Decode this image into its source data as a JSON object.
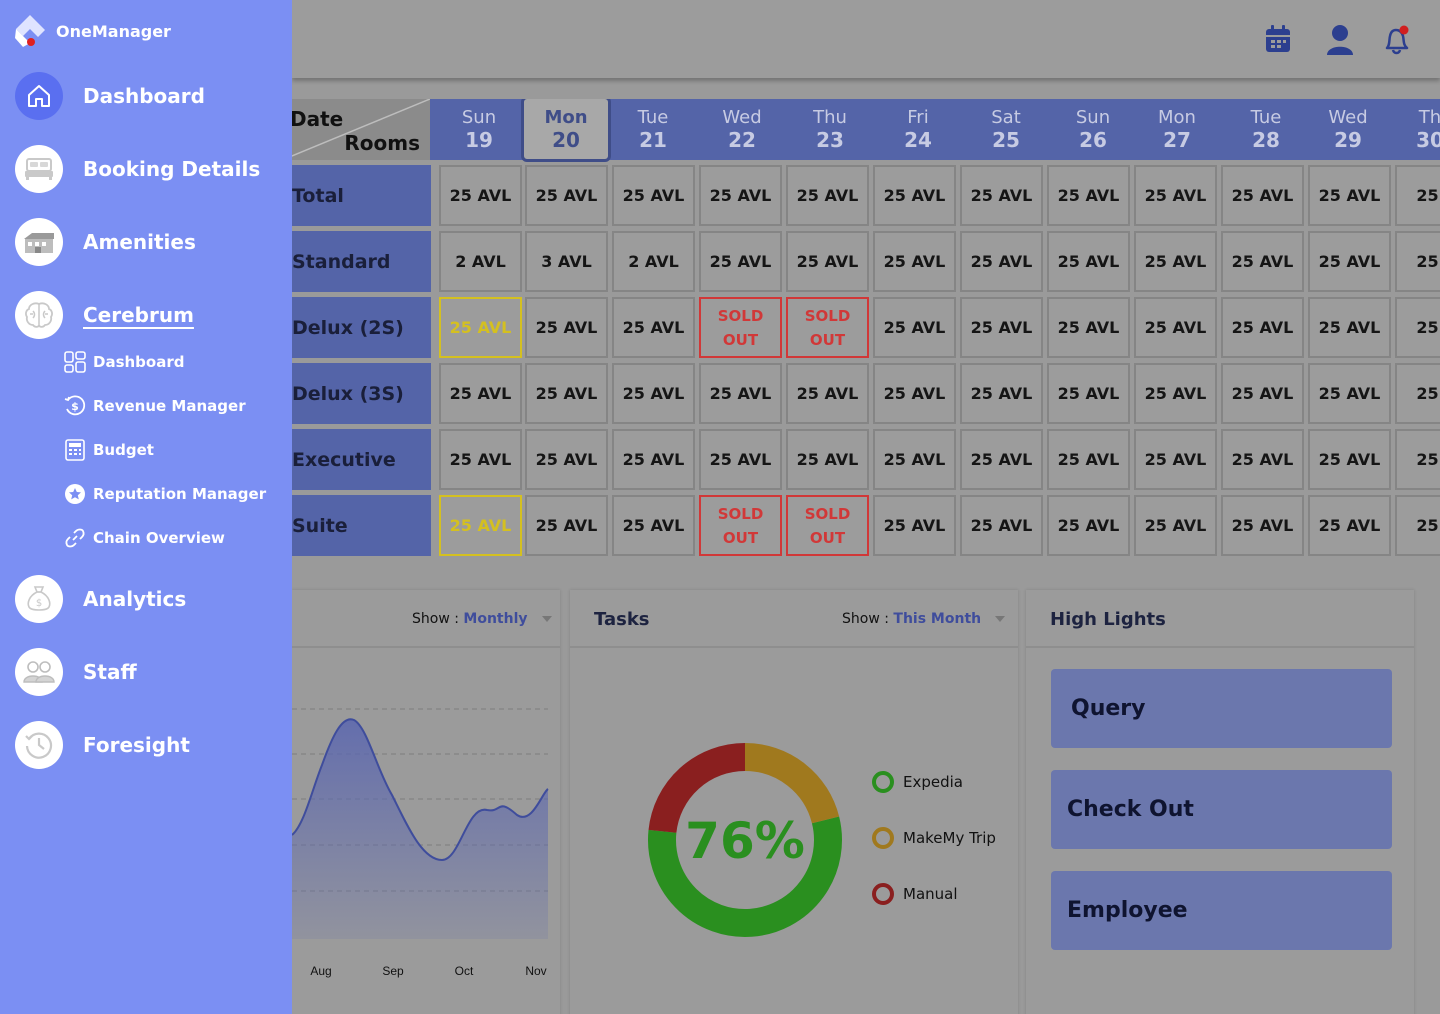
{
  "brand": {
    "name": "OneManager"
  },
  "nav": {
    "items": [
      {
        "label": "Dashboard",
        "icon": "home-icon"
      },
      {
        "label": "Booking Details",
        "icon": "bed-icon"
      },
      {
        "label": "Amenities",
        "icon": "building-icon"
      },
      {
        "label": "Cerebrum",
        "icon": "brain-icon"
      },
      {
        "label": "Analytics",
        "icon": "money-bag-icon"
      },
      {
        "label": "Staff",
        "icon": "people-icon"
      },
      {
        "label": "Foresight",
        "icon": "clock-icon"
      }
    ],
    "sub_items": [
      {
        "label": "Dashboard",
        "icon": "grid-icon"
      },
      {
        "label": "Revenue Manager",
        "icon": "revenue-icon"
      },
      {
        "label": "Budget",
        "icon": "calculator-icon"
      },
      {
        "label": "Reputation Manager",
        "icon": "star-badge-icon"
      },
      {
        "label": "Chain Overview",
        "icon": "link-icon"
      }
    ]
  },
  "grid": {
    "corner_top": "Date",
    "corner_bottom": "Rooms",
    "days": [
      {
        "name": "Sun",
        "date": "19"
      },
      {
        "name": "Mon",
        "date": "20"
      },
      {
        "name": "Tue",
        "date": "21"
      },
      {
        "name": "Wed",
        "date": "22"
      },
      {
        "name": "Thu",
        "date": "23"
      },
      {
        "name": "Fri",
        "date": "24"
      },
      {
        "name": "Sat",
        "date": "25"
      },
      {
        "name": "Sun",
        "date": "26"
      },
      {
        "name": "Mon",
        "date": "27"
      },
      {
        "name": "Tue",
        "date": "28"
      },
      {
        "name": "Wed",
        "date": "29"
      },
      {
        "name": "Th",
        "date": "30"
      }
    ],
    "selected_day": 1,
    "rows": [
      {
        "label": "Total",
        "cells": [
          "25 AVL",
          "25 AVL",
          "25 AVL",
          "25 AVL",
          "25 AVL",
          "25 AVL",
          "25 AVL",
          "25 AVL",
          "25 AVL",
          "25 AVL",
          "25 AVL",
          "25 A"
        ]
      },
      {
        "label": "Standard",
        "cells": [
          "2 AVL",
          "3 AVL",
          "2 AVL",
          "25 AVL",
          "25 AVL",
          "25 AVL",
          "25 AVL",
          "25 AVL",
          "25 AVL",
          "25 AVL",
          "25 AVL",
          "25 A"
        ]
      },
      {
        "label": "Delux (2S)",
        "cells": [
          "25 AVL",
          "25 AVL",
          "25 AVL",
          "SOLD OUT",
          "SOLD OUT",
          "25 AVL",
          "25 AVL",
          "25 AVL",
          "25 AVL",
          "25 AVL",
          "25 AVL",
          "25 A"
        ]
      },
      {
        "label": "Delux (3S)",
        "cells": [
          "25 AVL",
          "25 AVL",
          "25 AVL",
          "25 AVL",
          "25 AVL",
          "25 AVL",
          "25 AVL",
          "25 AVL",
          "25 AVL",
          "25 AVL",
          "25 AVL",
          "25 A"
        ]
      },
      {
        "label": "Executive",
        "cells": [
          "25 AVL",
          "25 AVL",
          "25 AVL",
          "25 AVL",
          "25 AVL",
          "25 AVL",
          "25 AVL",
          "25 AVL",
          "25 AVL",
          "25 AVL",
          "25 AVL",
          "25 A"
        ]
      },
      {
        "label": "Suite",
        "cells": [
          "25 AVL",
          "25 AVL",
          "25 AVL",
          "SOLD OUT",
          "SOLD OUT",
          "25 AVL",
          "25 AVL",
          "25 AVL",
          "25 AVL",
          "25 AVL",
          "25 AVL",
          "25 A"
        ]
      }
    ],
    "highlighted_cells": [
      [
        2,
        0
      ],
      [
        5,
        0
      ]
    ],
    "colors": {
      "highlight": "#d4c020",
      "sold_out": "#d13838",
      "header": "#5464a8"
    }
  },
  "trend_panel": {
    "show_label": "Show : ",
    "show_value": "Monthly",
    "chart_data": {
      "type": "area",
      "x_labels": [
        "Aug",
        "Sep",
        "Oct",
        "Nov"
      ],
      "color": "#5a66b0"
    }
  },
  "tasks_panel": {
    "title": "Tasks",
    "show_label": "Show : ",
    "show_value": "This Month",
    "percent": "76%",
    "chart_data": {
      "type": "pie",
      "series": [
        {
          "name": "Expedia",
          "color": "#2a8f1f"
        },
        {
          "name": "MakeMy Trip",
          "color": "#a0791e"
        },
        {
          "name": "Manual",
          "color": "#8a1f1f"
        }
      ]
    }
  },
  "highlights_panel": {
    "title": "High Lights",
    "items": [
      "Query",
      "Check Out",
      "Employee"
    ]
  },
  "header_icons": [
    "calendar-icon",
    "user-icon",
    "bell-icon"
  ]
}
